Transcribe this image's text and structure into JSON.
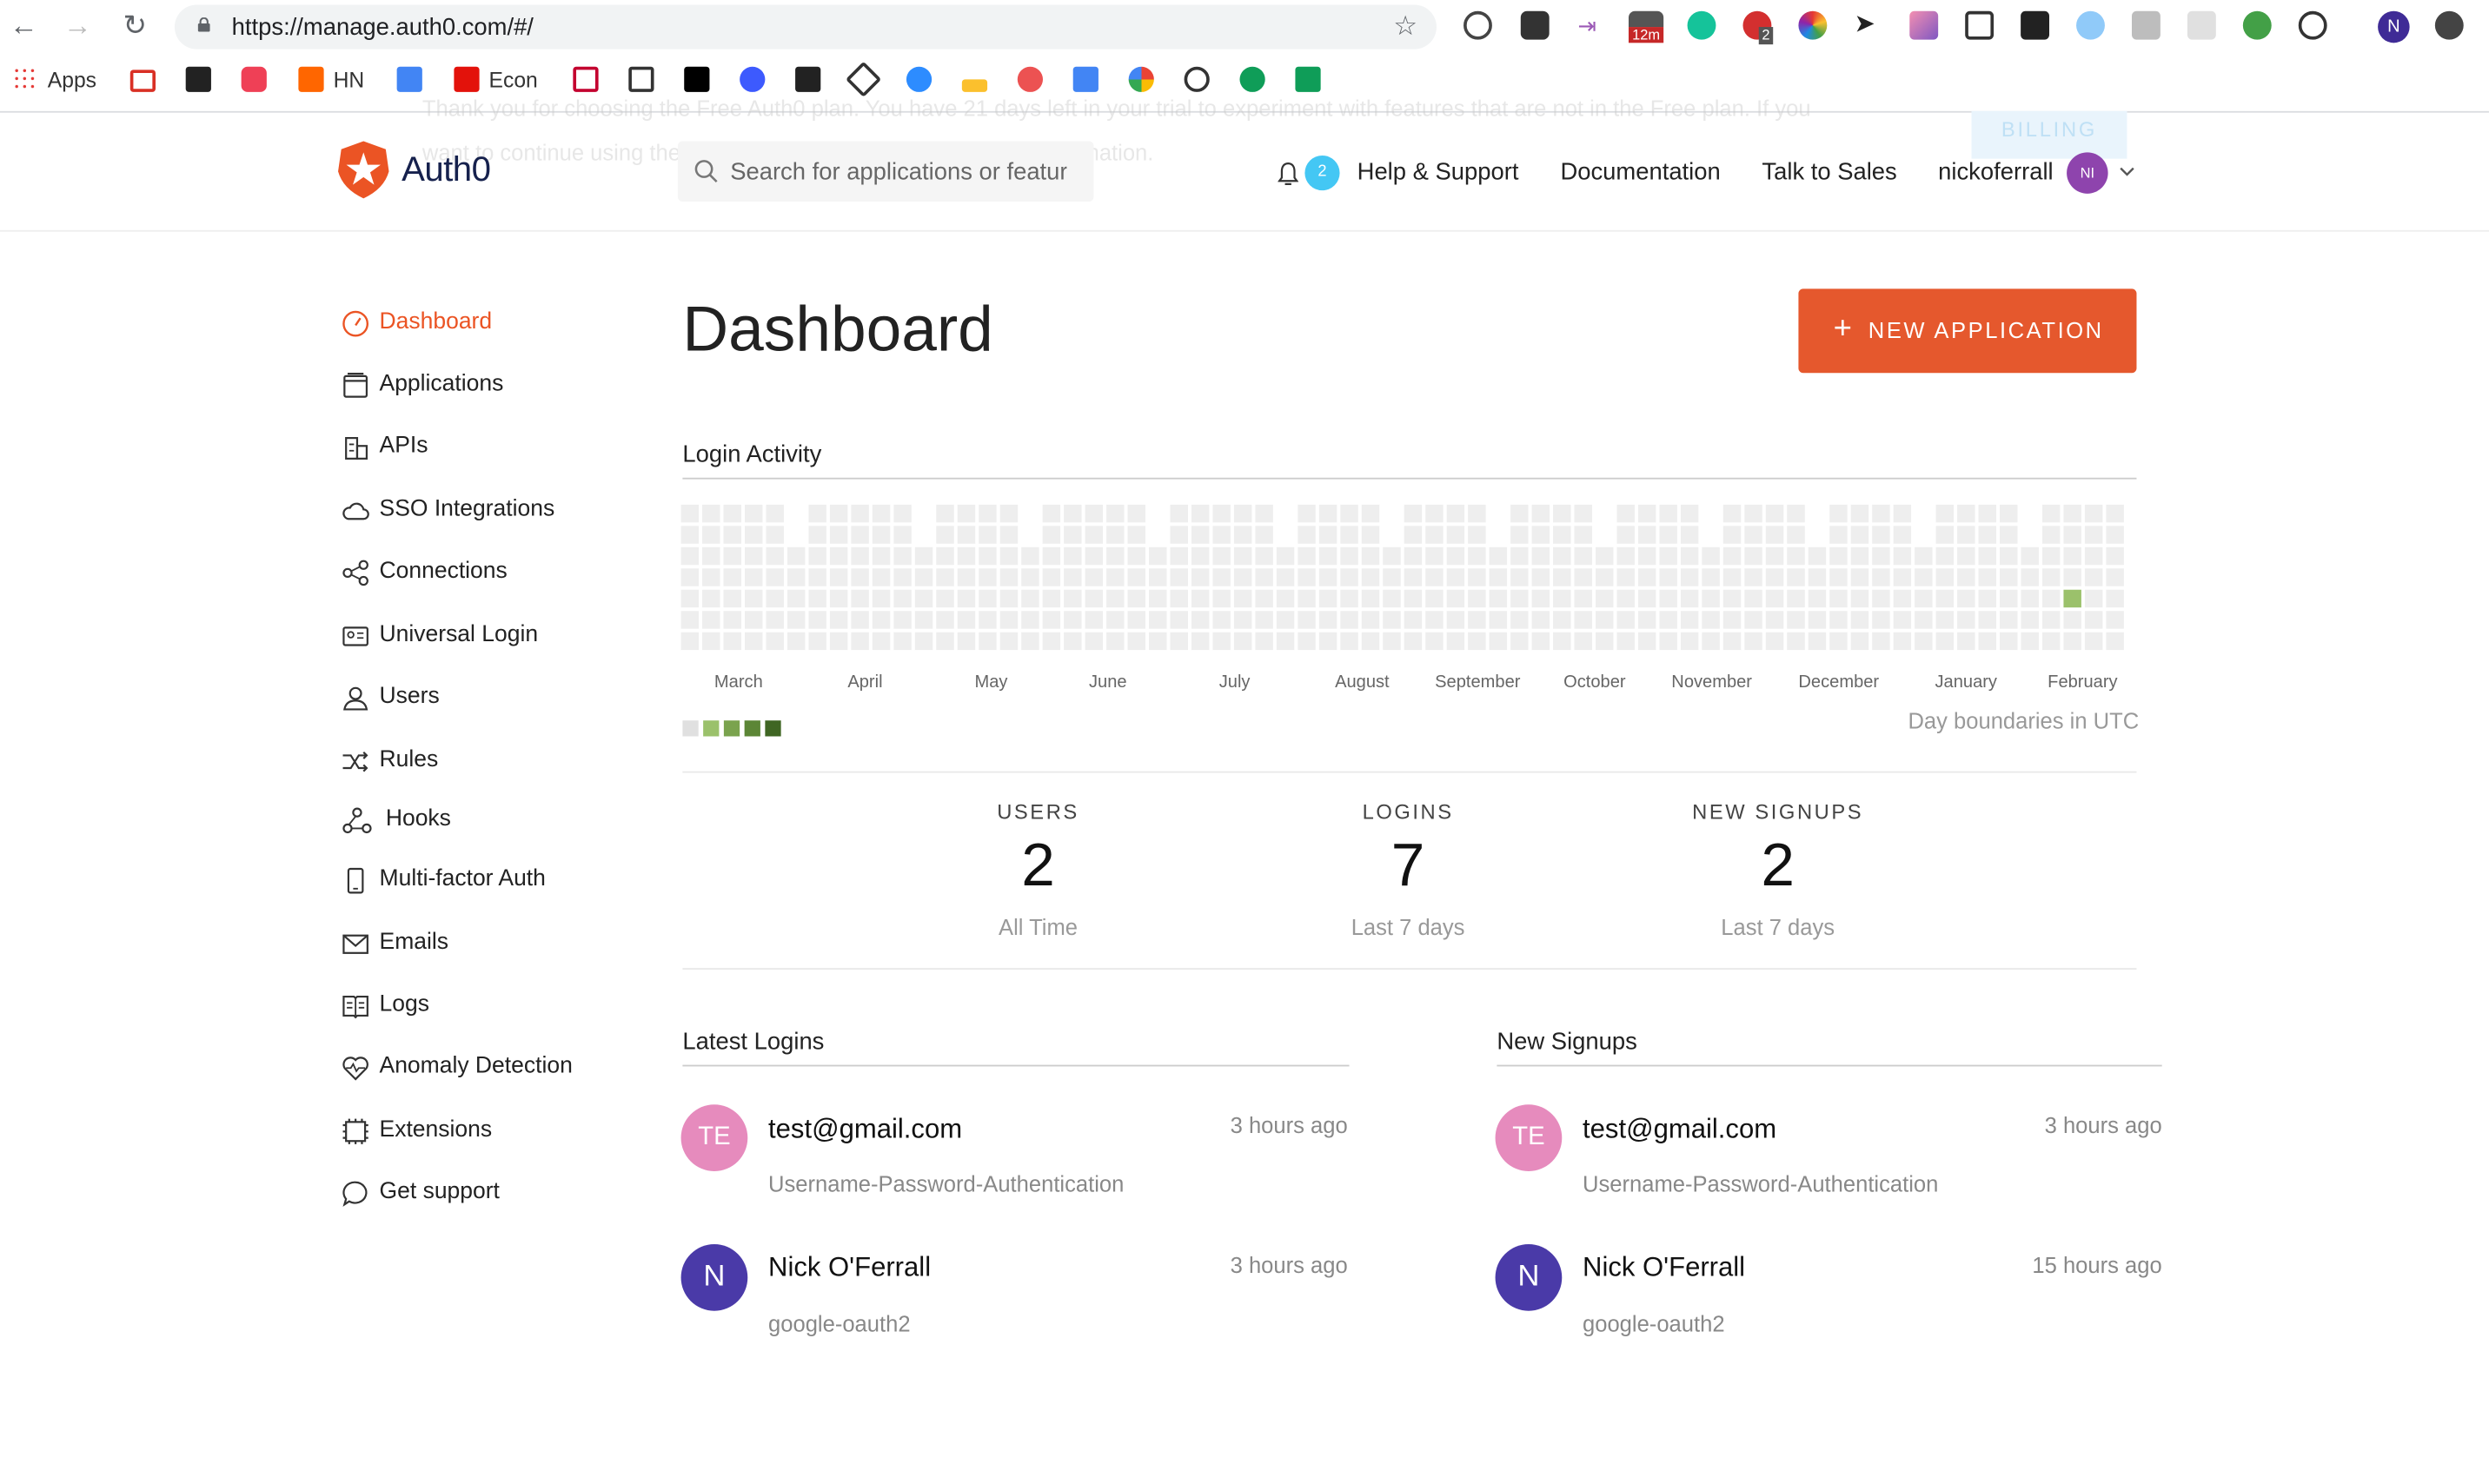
{
  "browser": {
    "url": "https://manage.auth0.com/#/",
    "bookmarks": [
      "Apps",
      "HN",
      "Econ"
    ],
    "extension_badges": [
      "12m",
      "2"
    ]
  },
  "banner": {
    "line1": "Thank you for choosing the Free Auth0 plan. You have 21 days left in your trial to experiment with features that are not in the Free plan. If you",
    "line2": "want to continue using the features, please update your billing information.",
    "billing_label": "BILLING"
  },
  "header": {
    "logo_text": "Auth0",
    "search_placeholder": "Search for applications or features",
    "notification_count": "2",
    "links": [
      "Help & Support",
      "Documentation",
      "Talk to Sales"
    ],
    "username": "nickoferrall",
    "user_initials": "NI"
  },
  "sidebar": {
    "items": [
      {
        "label": "Dashboard",
        "icon": "dashboard-icon",
        "active": true
      },
      {
        "label": "Applications",
        "icon": "applications-icon"
      },
      {
        "label": "APIs",
        "icon": "apis-icon"
      },
      {
        "label": "SSO Integrations",
        "icon": "cloud-icon"
      },
      {
        "label": "Connections",
        "icon": "connections-icon"
      },
      {
        "label": "Universal Login",
        "icon": "universal-login-icon"
      },
      {
        "label": "Users",
        "icon": "users-icon"
      },
      {
        "label": "Rules",
        "icon": "rules-icon"
      },
      {
        "label": "Hooks",
        "icon": "hooks-icon"
      },
      {
        "label": "Multi-factor Auth",
        "icon": "phone-icon"
      },
      {
        "label": "Emails",
        "icon": "mail-icon"
      },
      {
        "label": "Logs",
        "icon": "logs-icon"
      },
      {
        "label": "Anomaly Detection",
        "icon": "heart-icon"
      },
      {
        "label": "Extensions",
        "icon": "extensions-icon"
      },
      {
        "label": "Get support",
        "icon": "chat-icon"
      }
    ]
  },
  "main": {
    "title": "Dashboard",
    "new_app_label": "NEW APPLICATION",
    "login_activity_title": "Login Activity",
    "months": [
      "March",
      "April",
      "May",
      "June",
      "July",
      "August",
      "September",
      "October",
      "November",
      "December",
      "January",
      "February"
    ],
    "utc_note": "Day boundaries in UTC",
    "stats": [
      {
        "label": "USERS",
        "value": "2",
        "sub": "All Time"
      },
      {
        "label": "LOGINS",
        "value": "7",
        "sub": "Last 7 days"
      },
      {
        "label": "NEW SIGNUPS",
        "value": "2",
        "sub": "Last 7 days"
      }
    ],
    "latest_logins": {
      "title": "Latest Logins",
      "entries": [
        {
          "initials": "TE",
          "name": "test@gmail.com",
          "connection": "Username-Password-Authentication",
          "time": "3 hours ago"
        },
        {
          "initials": "N",
          "name": "Nick O'Ferrall",
          "connection": "google-oauth2",
          "time": "3 hours ago"
        }
      ]
    },
    "new_signups": {
      "title": "New Signups",
      "entries": [
        {
          "initials": "TE",
          "name": "test@gmail.com",
          "connection": "Username-Password-Authentication",
          "time": "3 hours ago"
        },
        {
          "initials": "N",
          "name": "Nick O'Ferrall",
          "connection": "google-oauth2",
          "time": "15 hours ago"
        }
      ]
    }
  },
  "colors": {
    "accent": "#eb5424",
    "button": "#e5582d",
    "avatar_te": "#e68bbd",
    "avatar_n": "#4a3aa8",
    "heat_empty": "#eeeeee",
    "heat_levels": [
      "#e0e0e0",
      "#9bc16b",
      "#7aa34e",
      "#5c8636",
      "#3f6623"
    ]
  }
}
